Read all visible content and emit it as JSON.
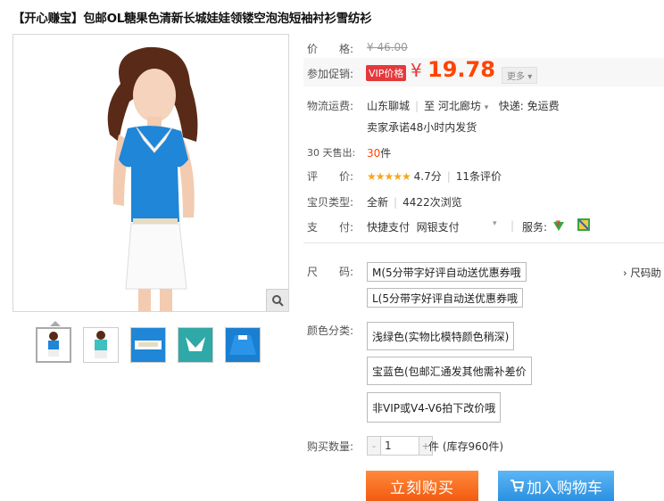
{
  "title": "【开心赚宝】包邮OL糖果色清新长城娃娃领镂空泡泡短袖衬衫雪纺衫",
  "price": {
    "label": "价　　格:",
    "original": "¥ 46.00"
  },
  "promo": {
    "label": "参加促销:",
    "badge": "VIP价格",
    "currency": "¥",
    "value": "19.78",
    "more": "更多"
  },
  "shipping": {
    "label": "物流运费:",
    "from": "山东聊城",
    "to_label": "至",
    "to": "河北廊坊",
    "express": "快递: 免运费",
    "promise": "卖家承诺48小时内发货"
  },
  "sales": {
    "label": "30 天售出:",
    "count": "30",
    "unit": "件"
  },
  "rating": {
    "label": "评　　价:",
    "stars": "★★★★★",
    "score": "4.7分",
    "reviews": "11条评价"
  },
  "item_type": {
    "label": "宝贝类型:",
    "value": "全新",
    "views": "4422次浏览"
  },
  "payment": {
    "label": "支　　付:",
    "methods": "快捷支付  网银支付",
    "service_label": "服务:"
  },
  "size": {
    "label": "尺　　码:",
    "options": [
      "M(5分带字好评自动送优惠券哦",
      "L(5分带字好评自动送优惠券哦"
    ],
    "help": "› 尺码助"
  },
  "color": {
    "label": "颜色分类:",
    "options": [
      "浅绿色(实物比模特颜色稍深)",
      "宝蓝色(包邮汇通发其他需补差价",
      "非VIP或V4-V6拍下改价哦"
    ]
  },
  "quantity": {
    "label": "购买数量:",
    "minus": "-",
    "value": "1",
    "plus": "+",
    "stock": "件 (库存960件)"
  },
  "buttons": {
    "buy": "立刻购买",
    "cart": "加入购物车"
  },
  "colors": {
    "accent": "#f40",
    "buy": "#f25b10",
    "cart": "#2a90e0",
    "badge": "#e4393c"
  }
}
